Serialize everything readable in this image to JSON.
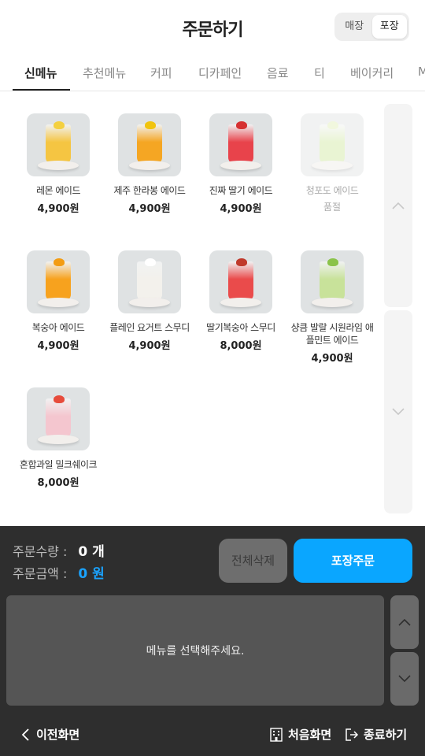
{
  "header": {
    "title": "주문하기",
    "modes": [
      "매장",
      "포장"
    ],
    "active_mode": "포장"
  },
  "tabs": [
    {
      "label": "신메뉴",
      "active": true
    },
    {
      "label": "추천메뉴",
      "active": false
    },
    {
      "label": "커피",
      "active": false
    },
    {
      "label": "디카페인",
      "active": false
    },
    {
      "label": "음료",
      "active": false
    },
    {
      "label": "티",
      "active": false
    },
    {
      "label": "베이커리",
      "active": false
    },
    {
      "label": "M",
      "active": false
    }
  ],
  "menu": [
    {
      "name": "레몬 에이드",
      "price": "4,900원",
      "drink_color": "#f5c542",
      "topper_color": "#f4d03f",
      "bg": "#dfe2e3"
    },
    {
      "name": "제주 한라봉 에이드",
      "price": "4,900원",
      "drink_color": "#f5a623",
      "topper_color": "#f1c40f",
      "bg": "#dfe2e3"
    },
    {
      "name": "진짜 딸기 에이드",
      "price": "4,900원",
      "drink_color": "#e8434b",
      "topper_color": "#d63031",
      "bg": "#dfe2e3"
    },
    {
      "name": "청포도 에이드",
      "price": "품절",
      "drink_color": "#d8ecb0",
      "topper_color": "#e6f2c4",
      "bg": "#e6e8e8",
      "soldout": true
    },
    {
      "name": "복숭아 에이드",
      "price": "4,900원",
      "drink_color": "#f7a21e",
      "topper_color": "#f39c12",
      "bg": "#dfe2e3"
    },
    {
      "name": "플레인 요거트 스무디",
      "price": "4,900원",
      "drink_color": "#f3f1ec",
      "topper_color": "#ffffff",
      "bg": "#dfe2e3"
    },
    {
      "name": "딸기복숭아 스무디",
      "price": "8,000원",
      "drink_color": "#ea4b4b",
      "topper_color": "#c0392b",
      "bg": "#dfe2e3"
    },
    {
      "name": "샹큼 발랄 시원라임 애플민트 에이드",
      "price": "4,900원",
      "drink_color": "#c8e29a",
      "topper_color": "#8bc34a",
      "bg": "#dfe2e3"
    },
    {
      "name": "혼합과일 밀크쉐이크",
      "price": "8,000원",
      "drink_color": "#f4c6cf",
      "topper_color": "#e74c3c",
      "bg": "#dfe2e3"
    }
  ],
  "order": {
    "qty_label": "주문수량 :",
    "qty_value": "0 개",
    "amount_label": "주문금액 :",
    "amount_value": "0 원",
    "clear_label": "전체삭제",
    "order_label": "포장주문",
    "empty_message": "메뉴를 선택해주세요."
  },
  "nav": {
    "prev": "이전화면",
    "home": "처음화면",
    "exit": "종료하기"
  },
  "colors": {
    "accent": "#0aa6ff",
    "panel": "#2e2e2e"
  }
}
